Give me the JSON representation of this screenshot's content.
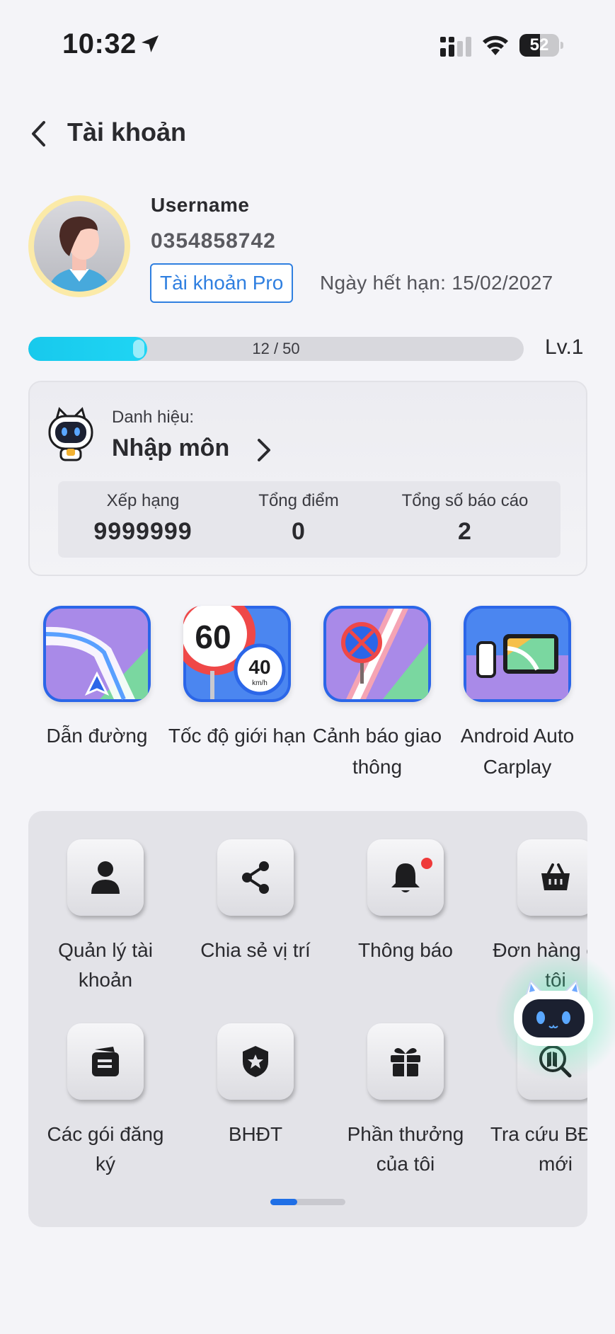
{
  "status_bar": {
    "time": "10:32",
    "battery": "52",
    "battery_level": 0.52
  },
  "header": {
    "title": "Tài khoản"
  },
  "profile": {
    "username": "Username",
    "phone": "0354858742",
    "account_type": "Tài khoản Pro",
    "expiry": "Ngày hết hạn: 15/02/2027"
  },
  "progress": {
    "text": "12 / 50",
    "current": 12,
    "max": 50,
    "level": "Lv.1"
  },
  "rank_card": {
    "title_caption": "Danh hiệu:",
    "title_value": "Nhập môn",
    "stats": [
      {
        "label": "Xếp hạng",
        "value": "9999999"
      },
      {
        "label": "Tổng điểm",
        "value": "0"
      },
      {
        "label": "Tổng số báo cáo",
        "value": "2"
      }
    ]
  },
  "features": [
    {
      "label": "Dẫn đường",
      "icon": "navigation-map-icon"
    },
    {
      "label": "Tốc độ giới hạn",
      "icon": "speed-limit-icon",
      "speed_big": "60",
      "speed_small": "40",
      "speed_unit": "km/h"
    },
    {
      "label": "Cảnh báo giao thông",
      "icon": "traffic-warning-icon"
    },
    {
      "label": "Android Auto Carplay",
      "icon": "android-auto-carplay-icon"
    }
  ],
  "menu": [
    {
      "label": "Quản lý tài khoản",
      "icon": "user-icon"
    },
    {
      "label": "Chia sẻ vị trí",
      "icon": "share-icon"
    },
    {
      "label": "Thông báo",
      "icon": "bell-icon"
    },
    {
      "label": "Đơn hàng của tôi",
      "icon": "basket-icon"
    },
    {
      "label": "Các gói đăng ký",
      "icon": "wallet-icon"
    },
    {
      "label": "BHĐT",
      "icon": "shield-star-icon"
    },
    {
      "label": "Phần thưởng của tôi",
      "icon": "gift-icon"
    },
    {
      "label": "Tra cứu BĐHC mới",
      "icon": "map-search-icon"
    }
  ],
  "pager": {
    "current": 1,
    "total": 3
  }
}
